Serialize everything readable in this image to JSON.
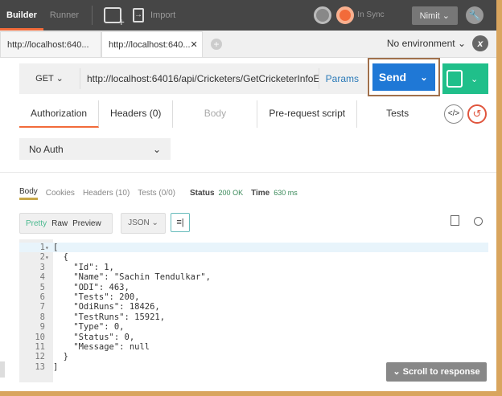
{
  "topbar": {
    "builder": "Builder",
    "runner": "Runner",
    "import": "Import",
    "sync": "In Sync",
    "user": "Nimit"
  },
  "tabs": [
    {
      "label": "http://localhost:640..."
    },
    {
      "label": "http://localhost:640..."
    }
  ],
  "environment": "No environment",
  "request": {
    "method": "GET",
    "url": "http://localhost:64016/api/Cricketers/GetCricketerInfoE",
    "params": "Params",
    "send": "Send"
  },
  "req_tabs": [
    "Authorization",
    "Headers (0)",
    "Body",
    "Pre-request script",
    "Tests"
  ],
  "auth": "No Auth",
  "response": {
    "tabs": [
      "Body",
      "Cookies",
      "Headers (10)",
      "Tests (0/0)"
    ],
    "status_label": "Status",
    "status": "200 OK",
    "time_label": "Time",
    "time": "630 ms",
    "views": [
      "Pretty",
      "Raw",
      "Preview"
    ],
    "format": "JSON",
    "scroll": "Scroll to response"
  },
  "code": [
    "[",
    "  {",
    "    \"Id\": 1,",
    "    \"Name\": \"Sachin Tendulkar\",",
    "    \"ODI\": 463,",
    "    \"Tests\": 200,",
    "    \"OdiRuns\": 18426,",
    "    \"TestRuns\": 15921,",
    "    \"Type\": 0,",
    "    \"Status\": 0,",
    "    \"Message\": null",
    "  }",
    "]"
  ]
}
